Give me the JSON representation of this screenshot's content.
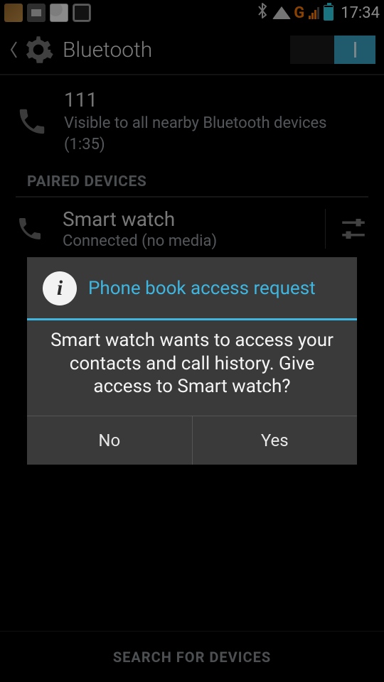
{
  "status_bar": {
    "clock": "17:34",
    "g_indicator": "G"
  },
  "header": {
    "title": "Bluetooth",
    "toggle_state": "on"
  },
  "this_device": {
    "name": "111",
    "subtitle_line1": "Visible to all nearby Bluetooth devices",
    "subtitle_line2": "(1:35)"
  },
  "sections": {
    "paired_header": "PAIRED DEVICES"
  },
  "paired": [
    {
      "name": "Smart watch",
      "status": "Connected (no media)"
    }
  ],
  "dialog": {
    "title": "Phone book access request",
    "body": "Smart watch wants to access your contacts and call history. Give access to Smart watch?",
    "no_label": "No",
    "yes_label": "Yes"
  },
  "footer": {
    "search_label": "SEARCH FOR DEVICES"
  },
  "icons": {
    "bluetooth": "bluetooth-icon",
    "wifi": "wifi-icon",
    "signal": "signal-icon",
    "battery": "battery-icon",
    "phone": "phone-icon",
    "gear": "gear-icon",
    "sliders": "sliders-icon",
    "info": "info-icon"
  }
}
